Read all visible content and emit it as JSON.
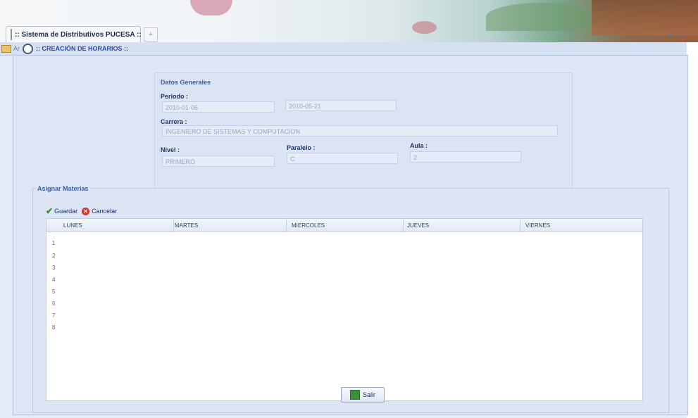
{
  "browser": {
    "tab_title": ":: Sistema de Distributivos PUCESA ::",
    "new_tab_symbol": "+",
    "window_controls": "▲ X"
  },
  "app": {
    "toolbar_label": "Ar",
    "window_title": ":: CREACIÓN DE HORARIOS ::"
  },
  "datos_generales": {
    "title": "Datos Generales",
    "periodo_label": "Periodo :",
    "periodo_inicio": "2010-01-06",
    "periodo_fin": "2010-05-21",
    "carrera_label": "Carrera :",
    "carrera_value": "INGENIERO DE SISTEMAS Y COMPUTACION",
    "nivel_label": "Nivel :",
    "nivel_value": "PRIMERO",
    "paralelo_label": "Paralelo :",
    "paralelo_value": "C",
    "aula_label": "Aula :",
    "aula_value": "2"
  },
  "asignar": {
    "title": "Asignar Materias",
    "guardar_label": "Guardar",
    "cancelar_label": "Cancelar",
    "columns": [
      "LUNES",
      "MARTES",
      "MIERCOLES",
      "JUEVES",
      "VIERNES"
    ],
    "rows": [
      "1",
      "2",
      "3",
      "4",
      "5",
      "6",
      "7",
      "8"
    ]
  },
  "salir_label": "Salir",
  "icons": [
    "document-icon",
    "folder-icon",
    "circle-icon",
    "check-icon",
    "cancel-icon",
    "exit-icon"
  ]
}
